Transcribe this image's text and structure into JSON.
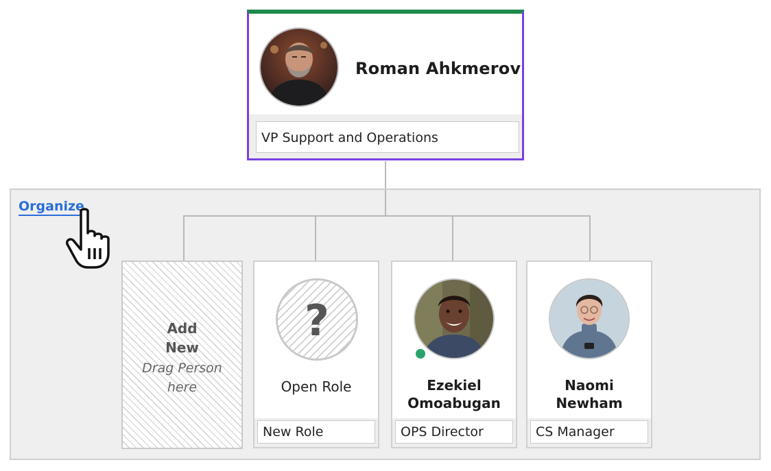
{
  "manager": {
    "name": "Roman Ahkmerov",
    "title": "VP Support and Operations",
    "photo_icon": "person-photo"
  },
  "organize": {
    "link_label": "Organize",
    "cursor_icon": "hand-pointer-cursor"
  },
  "placeholder": {
    "add_line1": "Add",
    "add_line2": "New",
    "drag_line1": "Drag Person",
    "drag_line2": "here"
  },
  "reports": [
    {
      "kind": "open-role",
      "label": "Open Role",
      "title": "New Role",
      "icon": "question-mark-icon"
    },
    {
      "kind": "person",
      "name_line1": "Ezekiel",
      "name_line2": "Omoabugan",
      "title": "OPS Director",
      "status": "online",
      "status_color": "#2aa36b"
    },
    {
      "kind": "person",
      "name_line1": "Naomi",
      "name_line2": "Newham",
      "title": "CS Manager"
    }
  ],
  "colors": {
    "selected_border": "#7a3fe4",
    "top_accent": "#1e8a4a",
    "link": "#2a6dd9"
  }
}
